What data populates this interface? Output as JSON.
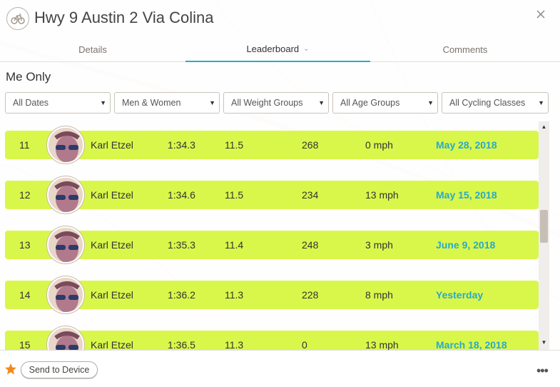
{
  "header": {
    "title": "Hwy 9 Austin 2 Via Colina"
  },
  "tabs": [
    {
      "label": "Details"
    },
    {
      "label": "Leaderboard"
    },
    {
      "label": "Comments"
    }
  ],
  "filter_title": "Me Only",
  "filters": [
    {
      "value": "All Dates"
    },
    {
      "value": "Men & Women"
    },
    {
      "value": "All Weight Groups"
    },
    {
      "value": "All Age Groups"
    },
    {
      "value": "All Cycling Classes"
    }
  ],
  "rows": [
    {
      "rank": "11",
      "name": "Karl Etzel",
      "time": "1:34.3",
      "speed": "11.5",
      "power": "268",
      "wind": "0 mph",
      "date": "May 28, 2018"
    },
    {
      "rank": "12",
      "name": "Karl Etzel",
      "time": "1:34.6",
      "speed": "11.5",
      "power": "234",
      "wind": "13 mph",
      "date": "May 15, 2018"
    },
    {
      "rank": "13",
      "name": "Karl Etzel",
      "time": "1:35.3",
      "speed": "11.4",
      "power": "248",
      "wind": "3 mph",
      "date": "June 9, 2018"
    },
    {
      "rank": "14",
      "name": "Karl Etzel",
      "time": "1:36.2",
      "speed": "11.3",
      "power": "228",
      "wind": "8 mph",
      "date": "Yesterday"
    },
    {
      "rank": "15",
      "name": "Karl Etzel",
      "time": "1:36.5",
      "speed": "11.3",
      "power": "0",
      "wind": "13 mph",
      "date": "March 18, 2018"
    }
  ],
  "footer": {
    "send_label": "Send to Device"
  },
  "colors": {
    "row_bg": "#d9f74a",
    "accent": "#2aa9c9",
    "star": "#f08a1c"
  }
}
